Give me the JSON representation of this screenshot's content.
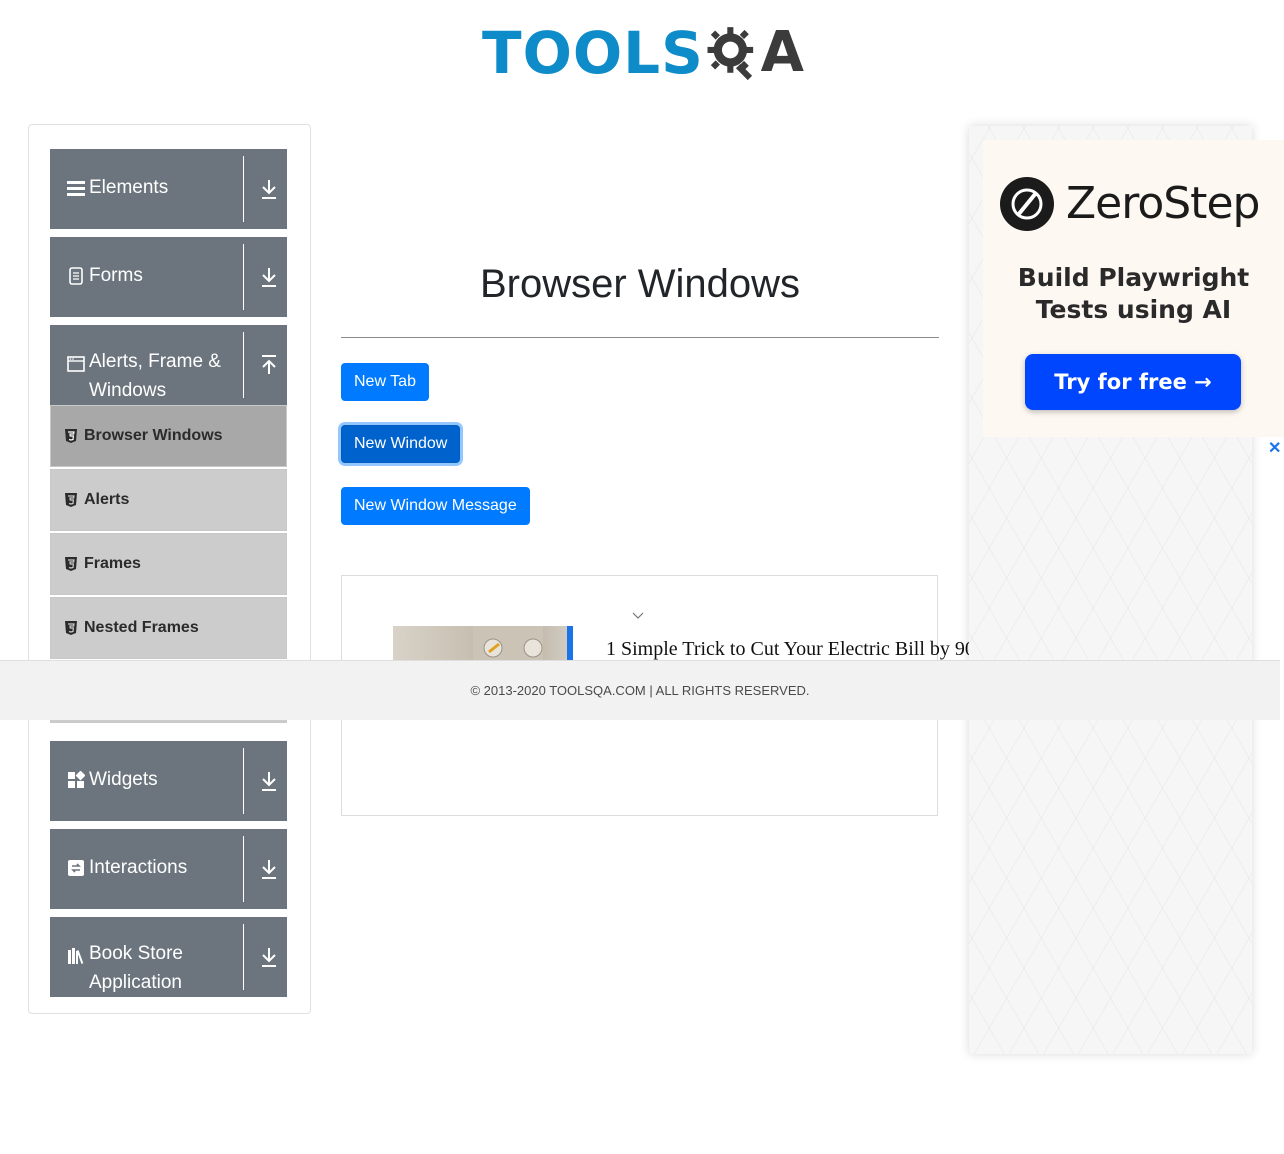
{
  "brand": {
    "logo_left": "TOOLS",
    "logo_right": "A"
  },
  "sidebar": {
    "groups": [
      {
        "label": "Elements",
        "icon": "menu-icon",
        "arrow": "download-arrow-icon"
      },
      {
        "label": "Forms",
        "icon": "document-icon",
        "arrow": "download-arrow-icon"
      },
      {
        "label": "Alerts, Frame & Windows",
        "icon": "window-icon",
        "arrow": "upload-arrow-icon"
      },
      {
        "label": "Widgets",
        "icon": "widgets-icon",
        "arrow": "download-arrow-icon"
      },
      {
        "label": "Interactions",
        "icon": "interactions-icon",
        "arrow": "download-arrow-icon"
      },
      {
        "label": "Book Store Application",
        "icon": "books-icon",
        "arrow": "download-arrow-icon"
      }
    ],
    "items": [
      {
        "label": "Browser Windows",
        "active": true
      },
      {
        "label": "Alerts",
        "active": false
      },
      {
        "label": "Frames",
        "active": false
      },
      {
        "label": "Nested Frames",
        "active": false
      }
    ]
  },
  "main": {
    "title": "Browser Windows",
    "buttons": {
      "new_tab": "New Tab",
      "new_window": "New Window",
      "new_window_message": "New Window Message"
    }
  },
  "content_ad": {
    "headline": "1 Simple Trick to Cut Your Electric Bill by 90",
    "close": "✕"
  },
  "right_ad": {
    "brand": "ZeroStep",
    "tagline": "Build Playwright Tests using AI",
    "cta": "Try for free →",
    "close": "✕",
    "accent": "#0046ff"
  },
  "footer": {
    "text": "© 2013-2020 TOOLSQA.COM | ALL RIGHTS RESERVED."
  },
  "colors": {
    "primary": "#007bff",
    "sidebar_header": "#6c757d",
    "logo_blue": "#0d8cc9"
  }
}
